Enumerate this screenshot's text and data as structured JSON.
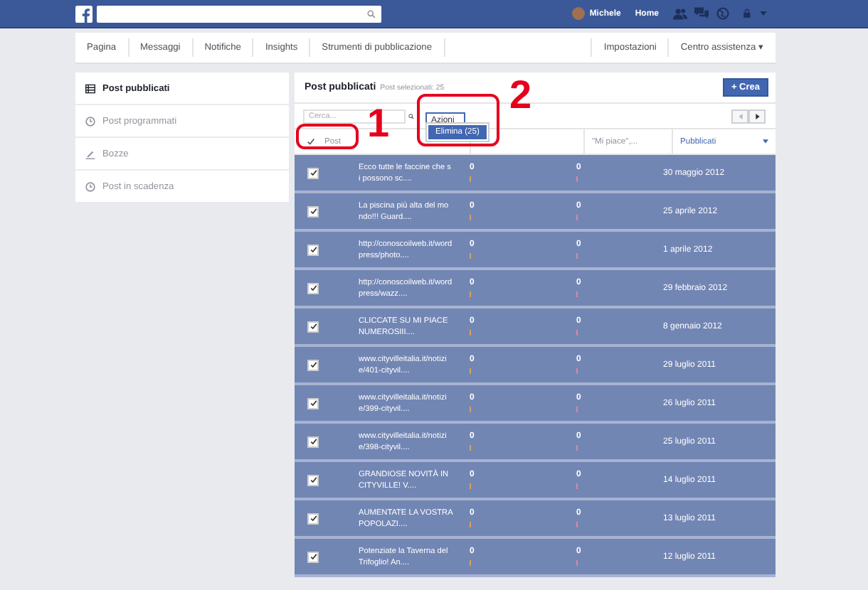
{
  "topbar": {
    "user": "Michele",
    "home": "Home"
  },
  "nav": {
    "left": [
      "Pagina",
      "Messaggi",
      "Notifiche",
      "Insights",
      "Strumenti di pubblicazione"
    ],
    "right": [
      "Impostazioni",
      "Centro assistenza ▾"
    ]
  },
  "sidebar": {
    "items": [
      {
        "label": "Post pubblicati",
        "selected": true
      },
      {
        "label": "Post programmati",
        "selected": false
      },
      {
        "label": "Bozze",
        "selected": false
      },
      {
        "label": "Post in scadenza",
        "selected": false
      }
    ]
  },
  "panel": {
    "title": "Post pubblicati",
    "subtitle": "Post selezionati: 25",
    "create_button": "+ Crea",
    "search": {
      "placeholder": "Cerca..."
    },
    "actions": {
      "label": "Azioni",
      "expanded": true,
      "menu": [
        "Elimina (25)"
      ]
    },
    "pager": {
      "prev_disabled": true,
      "next_disabled": false
    },
    "table": {
      "select_all": {
        "checked": true
      },
      "columns": [
        {
          "label": "Post",
          "sorted": false
        },
        {
          "label": "\"Mi piace\",...",
          "sorted": false
        },
        {
          "label": "Pubblicati",
          "sorted": true
        }
      ],
      "rows": [
        {
          "post": "Ecco tutte le faccine che si possono sc....",
          "reach": "0",
          "likes": "0",
          "date": "30 maggio 2012",
          "selected": true
        },
        {
          "post": "La piscina più alta del mondo!!! Guard....",
          "reach": "0",
          "likes": "0",
          "date": "25 aprile 2012",
          "selected": true
        },
        {
          "post": "http://conoscoilweb.it/wordpress/photo....",
          "reach": "0",
          "likes": "0",
          "date": "1 aprile 2012",
          "selected": true
        },
        {
          "post": "http://conoscoilweb.it/wordpress/wazz....",
          "reach": "0",
          "likes": "0",
          "date": "29 febbraio 2012",
          "selected": true
        },
        {
          "post": "CLICCATE SU MI PIACE NUMEROSIII....",
          "reach": "0",
          "likes": "0",
          "date": "8 gennaio 2012",
          "selected": true
        },
        {
          "post": "www.cityvilleitalia.it/notizie/401-cityvil....",
          "reach": "0",
          "likes": "0",
          "date": "29 luglio 2011",
          "selected": true
        },
        {
          "post": "www.cityvilleitalia.it/notizie/399-cityvil....",
          "reach": "0",
          "likes": "0",
          "date": "26 luglio 2011",
          "selected": true
        },
        {
          "post": "www.cityvilleitalia.it/notizie/398-cityvil....",
          "reach": "0",
          "likes": "0",
          "date": "25 luglio 2011",
          "selected": true
        },
        {
          "post": "GRANDIOSE NOVITÀ IN CITYVILLE! V....",
          "reach": "0",
          "likes": "0",
          "date": "14 luglio 2011",
          "selected": true
        },
        {
          "post": "AUMENTATE LA VOSTRA POPOLAZI....",
          "reach": "0",
          "likes": "0",
          "date": "13 luglio 2011",
          "selected": true
        },
        {
          "post": "Potenziate la Taverna del Trifoglio! An....",
          "reach": "0",
          "likes": "0",
          "date": "12 luglio 2011",
          "selected": true
        }
      ]
    }
  },
  "annotations": [
    {
      "label": "1"
    },
    {
      "label": "2"
    }
  ]
}
